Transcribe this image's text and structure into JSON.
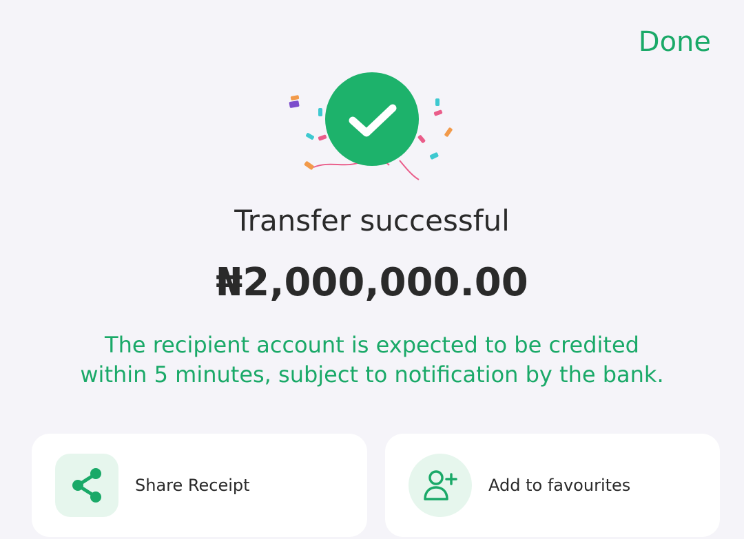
{
  "header": {
    "done_label": "Done"
  },
  "status": {
    "title": "Transfer successful",
    "amount": "₦2,000,000.00",
    "note": "The recipient account is expected to be credited within 5 minutes, subject to notification by the bank."
  },
  "actions": [
    {
      "label": "Share Receipt",
      "icon": "share-icon"
    },
    {
      "label": "Add to favourites",
      "icon": "add-user-icon"
    }
  ],
  "colors": {
    "accent": "#1aa968",
    "success_circle": "#1db26b",
    "background": "#f5f4f9",
    "card": "#ffffff",
    "icon_bg": "#e6f6ed"
  }
}
